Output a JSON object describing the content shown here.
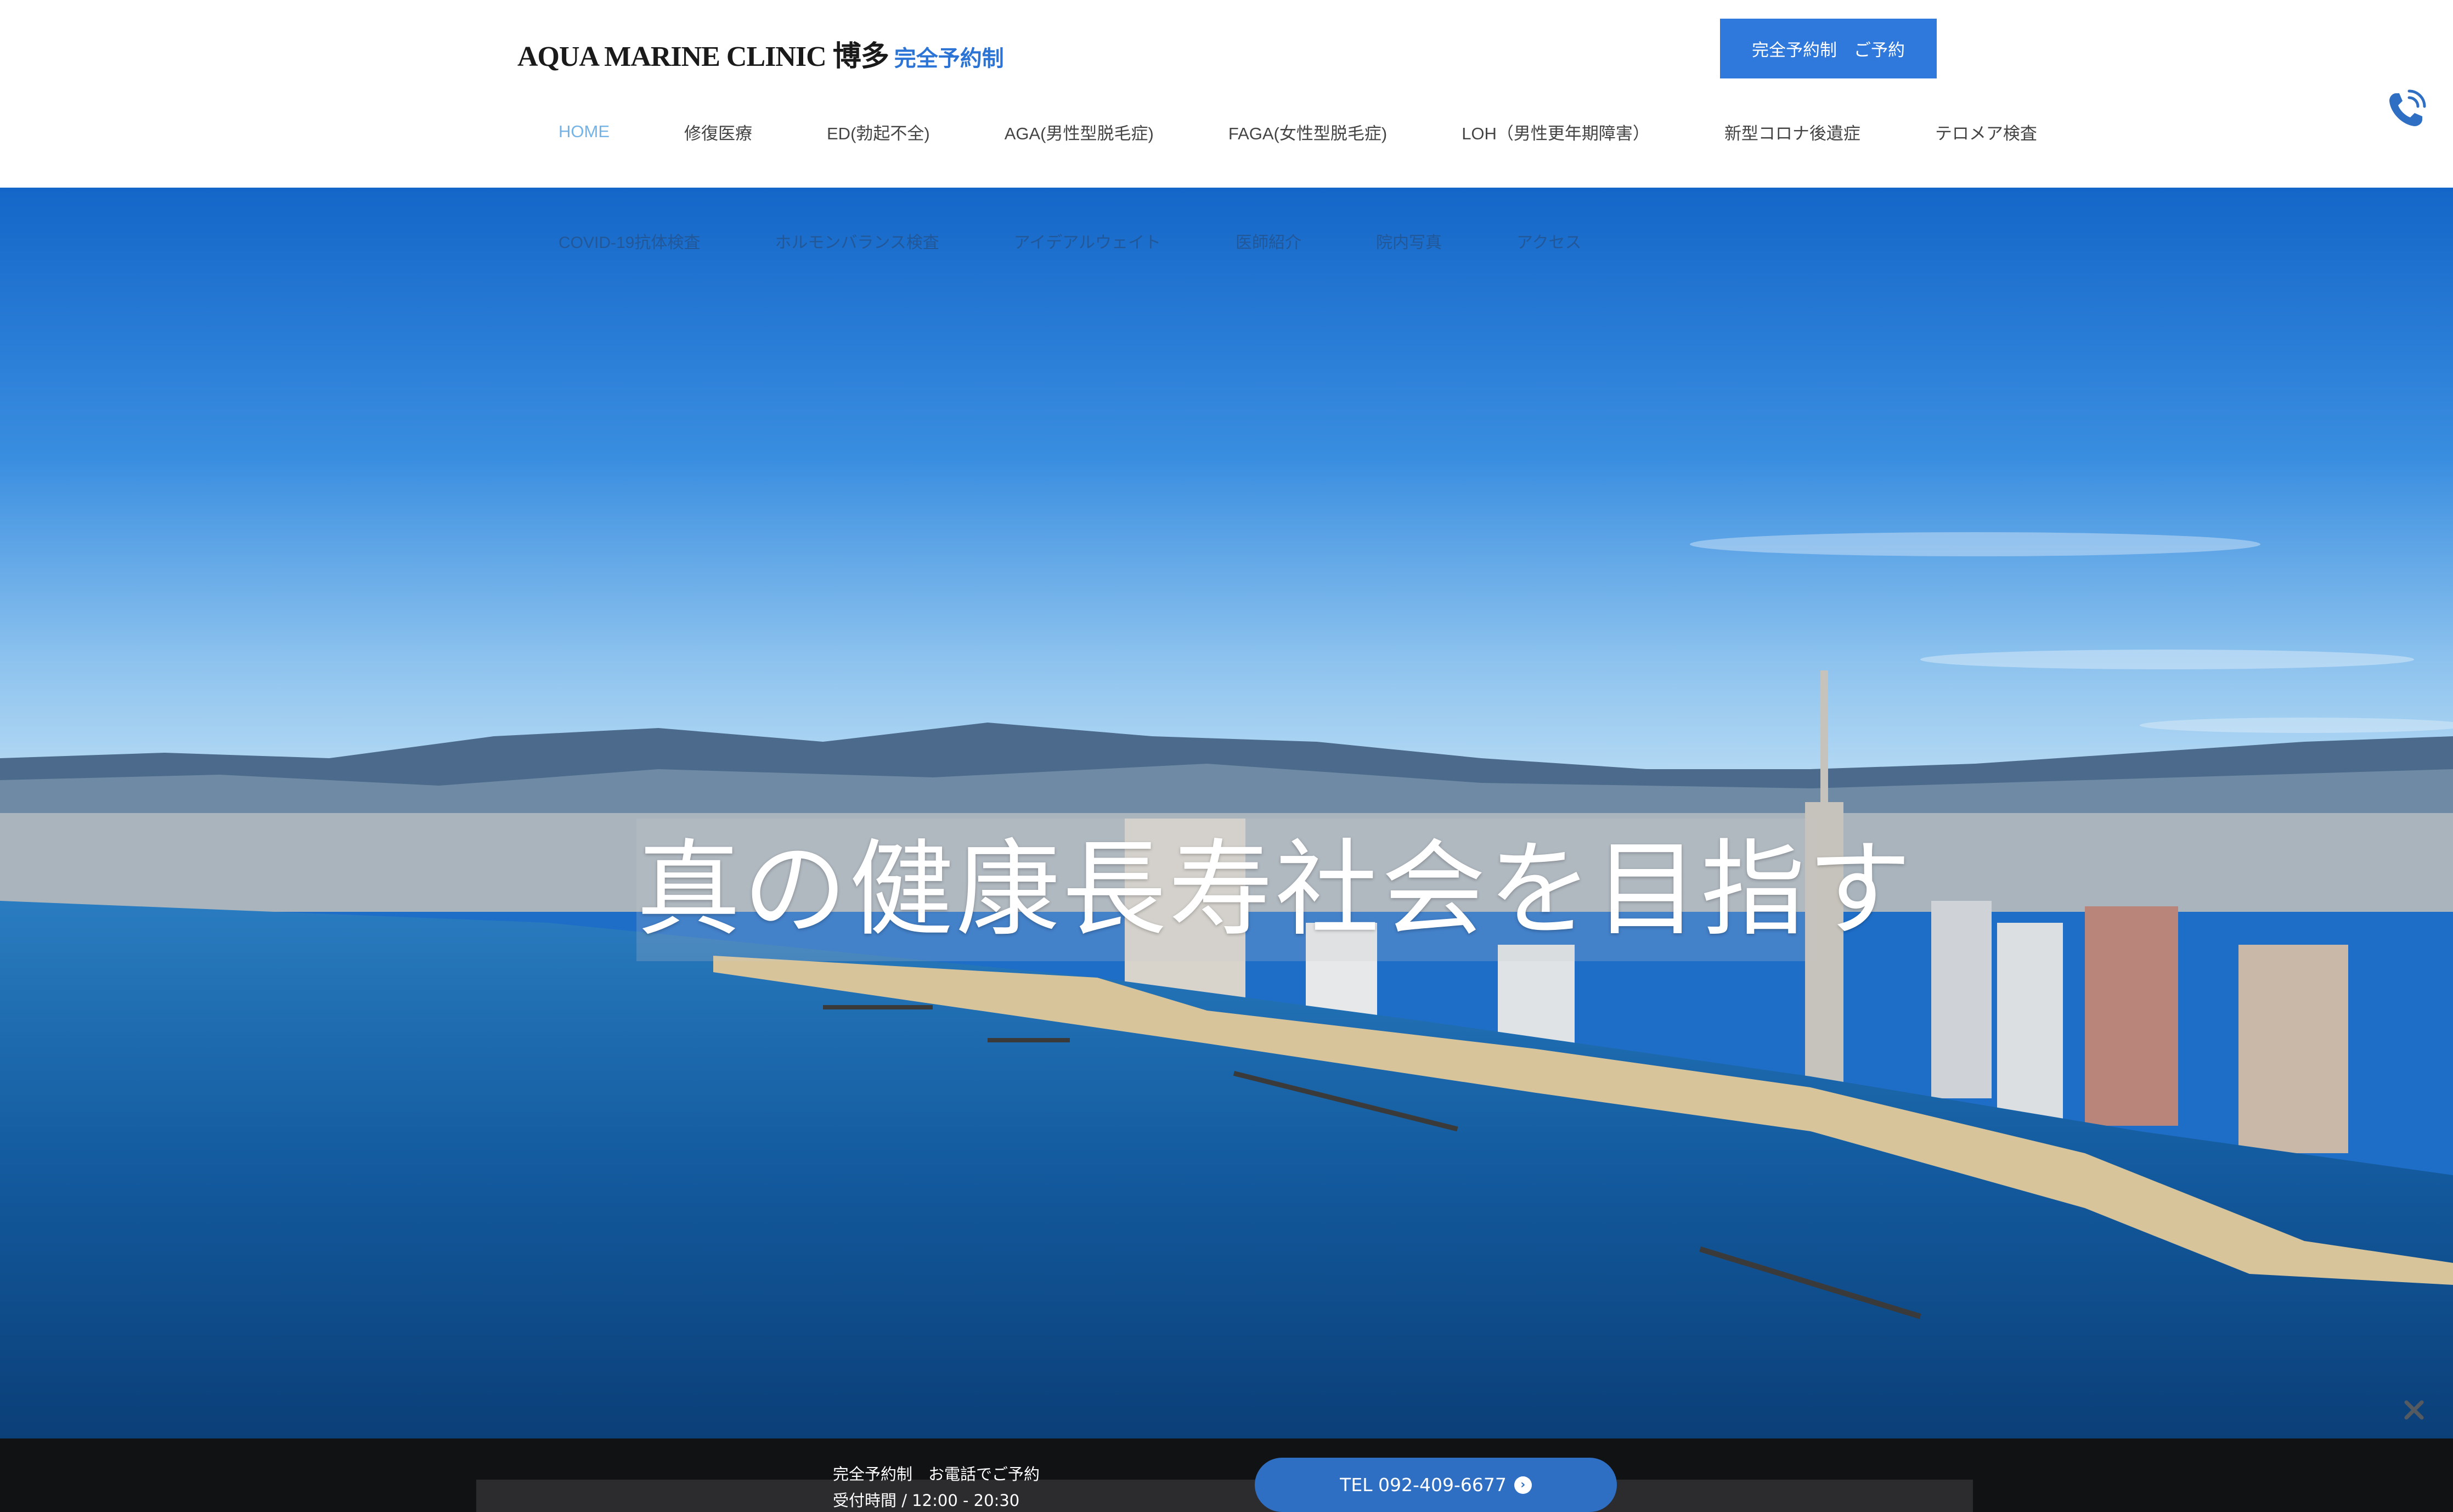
{
  "header": {
    "logo_main": "AQUA MARINE CLINIC 博多",
    "logo_sub": "完全予約制",
    "reserve_button": "完全予約制　ご予約"
  },
  "nav": {
    "row1": [
      "HOME",
      "修復医療",
      "ED(勃起不全)",
      "AGA(男性型脱毛症)",
      "FAGA(女性型脱毛症)",
      "LOH（男性更年期障害）",
      "新型コロナ後遺症",
      "テロメア検査"
    ],
    "row2": [
      "COVID-19抗体検査",
      "ホルモンバランス検査",
      "アイデアルウェイト",
      "医師紹介",
      "院内写真",
      "アクセス"
    ],
    "active": "HOME"
  },
  "hero": {
    "title": "真の健康長寿社会を目指す"
  },
  "footer": {
    "line1": "完全予約制　お電話でご予約",
    "line2": "受付時間 / 12:00 - 20:30",
    "tel_button": "TEL 092-409-6677"
  },
  "icons": {
    "phone": "phone-icon",
    "close": "close-icon",
    "arrow": "chevron-right-icon"
  },
  "colors": {
    "brand_blue": "#2f78dc",
    "nav_active": "#74b3e6",
    "footer_bg": "#101214"
  }
}
